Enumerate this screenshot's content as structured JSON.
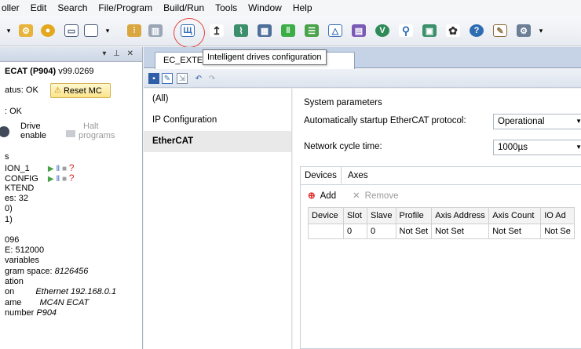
{
  "menubar": {
    "items": [
      "oller",
      "Edit",
      "Search",
      "File/Program",
      "Build/Run",
      "Tools",
      "Window",
      "Help"
    ]
  },
  "toolbar": {
    "tooltip": "Intelligent drives configuration"
  },
  "left_panel": {
    "device_title": "ECAT (P904)",
    "version": "v99.0269",
    "status": "atus: OK",
    "reset_button": "Reset MC",
    "status2": ": OK",
    "drive_enable_line1": "Drive",
    "drive_enable_line2": "enable",
    "halt_line1": "Halt",
    "halt_line2": "programs",
    "s_label": "s",
    "program1": "ION_1",
    "program2": "CONFIG",
    "program3": "KTEND",
    "es": "es: 32",
    "paren0": "0)",
    "paren1": "1)",
    "n096": "096",
    "e512": "E: 512000",
    "variables": "variables",
    "program_space_label": "gram space:",
    "program_space_value": "8126456",
    "ation": "ation",
    "on_label": "on",
    "on_value": "Ethernet 192.168.0.1",
    "name_label": "ame",
    "name_value": "MC4N ECAT",
    "number_label": "number",
    "number_value": "P904"
  },
  "doc_tab": {
    "label": "EC_EXTEN",
    "label_tail": "N_1"
  },
  "nav": {
    "items": [
      "(All)",
      "IP Configuration",
      "EtherCAT"
    ],
    "selected": "EtherCAT"
  },
  "system_params": {
    "title": "System parameters",
    "autostart_label": "Automatically startup EtherCAT protocol:",
    "autostart_value": "Operational",
    "cycle_label": "Network cycle time:",
    "cycle_value": "1000µs"
  },
  "devices_panel": {
    "tabs": [
      "Devices",
      "Axes"
    ],
    "active_tab": "Devices",
    "add_label": "Add",
    "remove_label": "Remove",
    "columns": [
      "Device",
      "Slot",
      "Slave",
      "Profile",
      "Axis Address",
      "Axis Count",
      "IO Ad"
    ],
    "rows": [
      [
        "",
        "0",
        "0",
        "Not Set",
        "Not Set",
        "Not Set",
        "Not Se"
      ]
    ]
  },
  "colors": {
    "highlight_circle": "#e0443c",
    "toolbar_bg": "#e7ebf1",
    "selected_nav_bg": "#e9e9e9",
    "add_plus": "#e02a2a"
  }
}
